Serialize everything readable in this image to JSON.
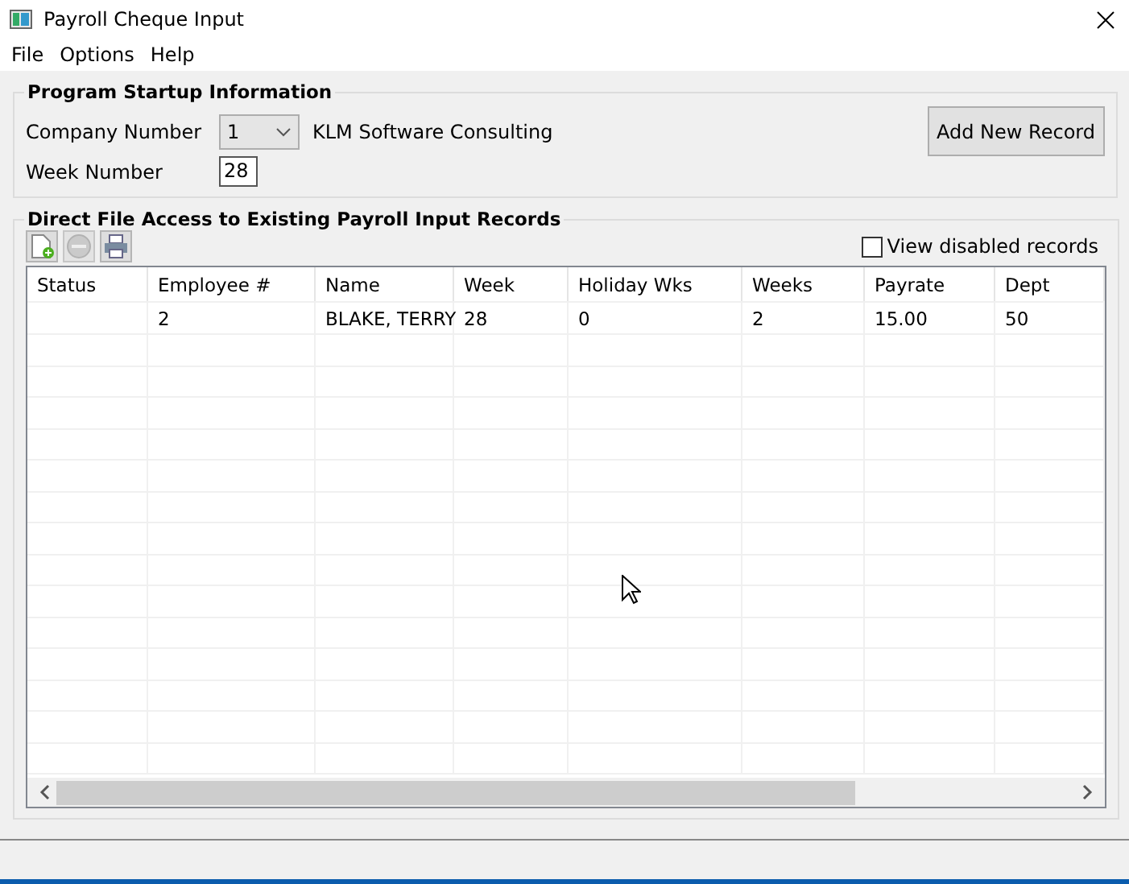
{
  "window": {
    "title": "Payroll Cheque Input"
  },
  "menu": [
    "File",
    "Options",
    "Help"
  ],
  "startup": {
    "title": "Program Startup Information",
    "company_label": "Company Number",
    "company_value": "1",
    "company_name": "KLM Software  Consulting",
    "week_label": "Week Number",
    "week_value": "28",
    "add_button": "Add New Record"
  },
  "records": {
    "title": "Direct File Access to Existing Payroll Input Records",
    "toolbar": [
      {
        "kind": "new",
        "disabled": false
      },
      {
        "kind": "delete",
        "disabled": true
      },
      {
        "kind": "print",
        "disabled": false
      }
    ],
    "view_disabled": {
      "label": "View disabled records",
      "checked": false
    },
    "table": {
      "columns": [
        "Status",
        "Employee #",
        "Name",
        "Week",
        "Holiday Wks",
        "Weeks",
        "Payrate",
        "Dept"
      ],
      "rows": [
        {
          "employee_no": "2",
          "name": "BLAKE, TERRY",
          "week": "28",
          "holiday_wks": "0",
          "weeks": "2",
          "payrate": "15.00",
          "dept": "50"
        }
      ]
    }
  }
}
